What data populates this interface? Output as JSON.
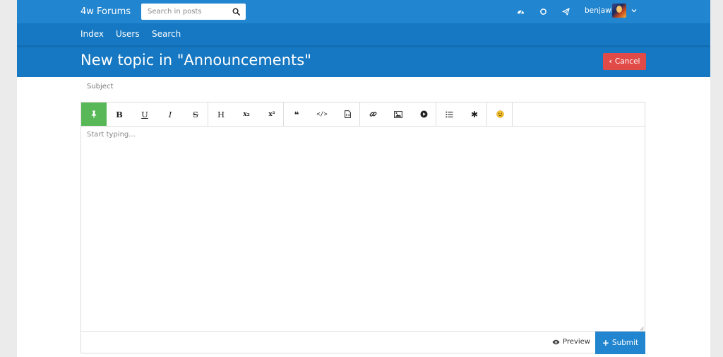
{
  "topbar": {
    "brand": "4w Forums",
    "search": {
      "placeholder": "Search in posts",
      "value": ""
    },
    "icons": [
      "dashboard-icon",
      "notifications-icon",
      "messages-icon"
    ],
    "username": "benjawl"
  },
  "nav": {
    "items": [
      {
        "label": "Index"
      },
      {
        "label": "Users"
      },
      {
        "label": "Search"
      }
    ]
  },
  "header": {
    "title": "New topic in \"Announcements\"",
    "cancel_label": "Cancel"
  },
  "composer": {
    "subject_placeholder": "Subject",
    "body_placeholder": "Start typing...",
    "toolbar": [
      {
        "name": "pin",
        "label": "",
        "active": true
      },
      {
        "name": "bold",
        "label": "B"
      },
      {
        "name": "underline",
        "label": "U"
      },
      {
        "name": "italic",
        "label": "I"
      },
      {
        "name": "strikethrough",
        "label": "S"
      },
      {
        "name": "heading",
        "label": "H"
      },
      {
        "name": "subscript",
        "label": "x₂"
      },
      {
        "name": "superscript",
        "label": "x²"
      },
      {
        "name": "quote",
        "label": "❝"
      },
      {
        "name": "code",
        "label": "</>"
      },
      {
        "name": "file",
        "label": ""
      },
      {
        "name": "link",
        "label": ""
      },
      {
        "name": "image",
        "label": ""
      },
      {
        "name": "video",
        "label": ""
      },
      {
        "name": "list",
        "label": ""
      },
      {
        "name": "asterisk",
        "label": "✱"
      },
      {
        "name": "emoji",
        "label": ""
      }
    ],
    "preview_label": "Preview",
    "submit_label": "Submit"
  },
  "colors": {
    "topbar": "#2185cf",
    "navbar": "#1678c2",
    "cancel": "#e04a47",
    "active_tool": "#58b857",
    "submit": "#2185cf"
  }
}
